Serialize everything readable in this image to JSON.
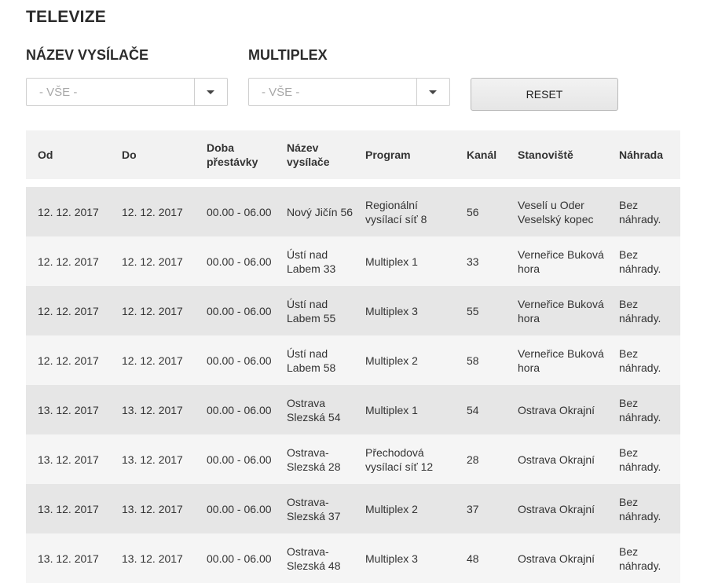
{
  "page": {
    "title": "TELEVIZE"
  },
  "filters": {
    "transmitter_label": "NÁZEV VYSÍLAČE",
    "transmitter_value": "- VŠE -",
    "multiplex_label": "MULTIPLEX",
    "multiplex_value": "- VŠE -",
    "reset_label": "RESET"
  },
  "table": {
    "headers": [
      "Od",
      "Do",
      "Doba přestávky",
      "Název vysílače",
      "Program",
      "Kanál",
      "Stanoviště",
      "Náhrada"
    ],
    "rows": [
      [
        "12. 12. 2017",
        "12. 12. 2017",
        "00.00 - 06.00",
        "Nový Jičín 56",
        "Regionální vysílací síť 8",
        "56",
        "Veselí u Oder Veselský kopec",
        "Bez náhrady."
      ],
      [
        "12. 12. 2017",
        "12. 12. 2017",
        "00.00 - 06.00",
        "Ústí nad Labem 33",
        "Multiplex 1",
        "33",
        "Verneřice Buková hora",
        "Bez náhrady."
      ],
      [
        "12. 12. 2017",
        "12. 12. 2017",
        "00.00 - 06.00",
        "Ústí nad Labem 55",
        "Multiplex 3",
        "55",
        "Verneřice Buková hora",
        "Bez náhrady."
      ],
      [
        "12. 12. 2017",
        "12. 12. 2017",
        "00.00 - 06.00",
        "Ústí nad Labem 58",
        "Multiplex 2",
        "58",
        "Verneřice Buková hora",
        "Bez náhrady."
      ],
      [
        "13. 12. 2017",
        "13. 12. 2017",
        "00.00 - 06.00",
        "Ostrava Slezská 54",
        "Multiplex 1",
        "54",
        "Ostrava Okrajní",
        "Bez náhrady."
      ],
      [
        "13. 12. 2017",
        "13. 12. 2017",
        "00.00 - 06.00",
        "Ostrava-Slezská 28",
        "Přechodová vysílací síť 12",
        "28",
        "Ostrava Okrajní",
        "Bez náhrady."
      ],
      [
        "13. 12. 2017",
        "13. 12. 2017",
        "00.00 - 06.00",
        "Ostrava-Slezská 37",
        "Multiplex 2",
        "37",
        "Ostrava Okrajní",
        "Bez náhrady."
      ],
      [
        "13. 12. 2017",
        "13. 12. 2017",
        "00.00 - 06.00",
        "Ostrava-Slezská 48",
        "Multiplex 3",
        "48",
        "Ostrava Okrajní",
        "Bez náhrady."
      ]
    ]
  }
}
